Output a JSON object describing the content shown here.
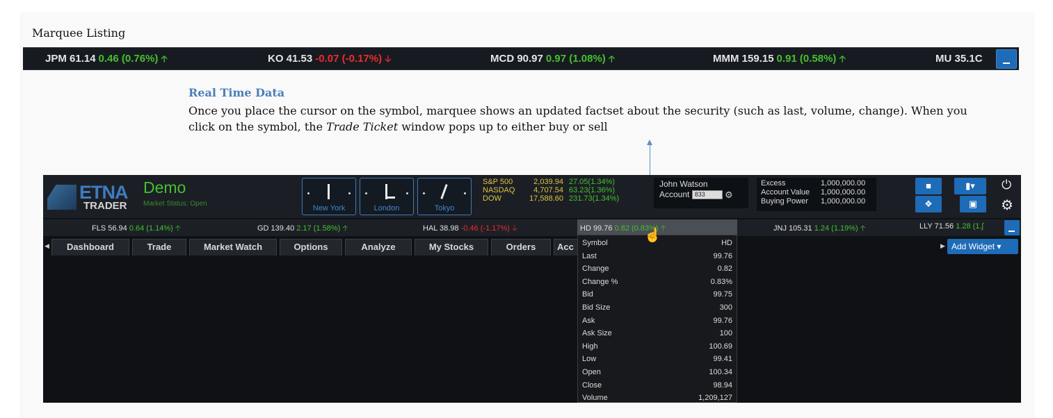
{
  "caption": "Marquee Listing",
  "top_marquee": {
    "items": [
      {
        "symbol": "JPM 61.14",
        "change": "0.46 (0.76%)",
        "direction": "up"
      },
      {
        "symbol": "KO 41.53",
        "change": "-0.07 (-0.17%)",
        "direction": "down"
      },
      {
        "symbol": "MCD 90.97",
        "change": "0.97 (1.08%)",
        "direction": "up"
      },
      {
        "symbol": "MMM 159.15",
        "change": "0.91 (0.58%)",
        "direction": "up"
      },
      {
        "symbol": "MU 35.1С",
        "change": "",
        "direction": ""
      }
    ]
  },
  "annotation": {
    "title": "Real Time Data",
    "body_1": "Once you place the cursor on the symbol, marquee shows an updated factset about the security (such as last, volume, change). When you click on the symbol, the ",
    "body_em": "Trade Ticket",
    "body_2": " window pops up to either buy or sell"
  },
  "app": {
    "logo_etna": "ETNA",
    "logo_trader": "TRADER",
    "mode": "Demo",
    "market_status": "Market Status: Open",
    "clocks": [
      "New York",
      "London",
      "Tokyo"
    ],
    "indices": [
      {
        "name": "S&P 500",
        "value": "2,039.94",
        "change": "27.05(1.34%)"
      },
      {
        "name": "NASDAQ",
        "value": "4,707.54",
        "change": "63.23(1.36%)"
      },
      {
        "name": "DOW",
        "value": "17,588.60",
        "change": "231.73(1.34%)"
      }
    ],
    "user": {
      "name": "John Watson",
      "account_label": "Account",
      "account_value": "833"
    },
    "balances": [
      {
        "label": "Excess",
        "value": "1,000,000.00"
      },
      {
        "label": "Account Value",
        "value": "1,000,000.00"
      },
      {
        "label": "Buying Power",
        "value": "1,000,000.00"
      }
    ],
    "marquee": [
      {
        "symbol": "FLS 56.94",
        "change": "0.64 (1.14%)",
        "direction": "up"
      },
      {
        "symbol": "GD 139.40",
        "change": "2.17 (1.58%)",
        "direction": "up"
      },
      {
        "symbol": "HAL 38.98",
        "change": "-0.46 (-1.17%)",
        "direction": "down"
      },
      {
        "symbol": "HD 99.76",
        "change": "0.82 (0.83%)",
        "direction": "up"
      },
      {
        "symbol": "JNJ 105.31",
        "change": "1.24 (1.19%)",
        "direction": "up"
      },
      {
        "symbol": "LLY 71.56",
        "change": "1.28 (1.ʃ",
        "direction": ""
      }
    ],
    "tabs": [
      "Dashboard",
      "Trade",
      "Market Watch",
      "Options",
      "Analyze",
      "My Stocks",
      "Orders",
      "Acc"
    ],
    "add_widget": "Add Widget",
    "tooltip": [
      {
        "label": "Symbol",
        "value": "HD"
      },
      {
        "label": "Last",
        "value": "99.76"
      },
      {
        "label": "Change",
        "value": "0.82"
      },
      {
        "label": "Change %",
        "value": "0.83%"
      },
      {
        "label": "Bid",
        "value": "99.75"
      },
      {
        "label": "Bid Size",
        "value": "300"
      },
      {
        "label": "Ask",
        "value": "99.76"
      },
      {
        "label": "Ask Size",
        "value": "100"
      },
      {
        "label": "High",
        "value": "100.69"
      },
      {
        "label": "Low",
        "value": "99.41"
      },
      {
        "label": "Open",
        "value": "100.34"
      },
      {
        "label": "Close",
        "value": "98.94"
      },
      {
        "label": "Volume",
        "value": "1,209,127"
      }
    ]
  },
  "colors": {
    "up": "#45c02c",
    "down": "#ee2b2b",
    "accent": "#1e6bb8"
  },
  "icons": [
    "up-arrow-icon",
    "down-arrow-icon",
    "minimize-icon",
    "chat-icon",
    "flag-icon",
    "pin-icon",
    "save-icon",
    "power-icon",
    "gear-icon",
    "hand-cursor-icon"
  ]
}
